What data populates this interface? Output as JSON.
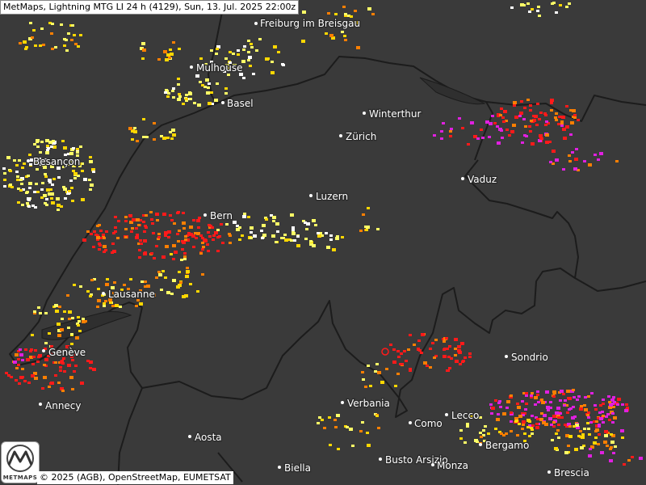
{
  "header": {
    "title": "MetMaps, Lightning MTG LI 24 h (4129), Sun, 13. Jul. 2025 22:00z"
  },
  "footer": {
    "attribution": "© 2025 (AGB), OpenStreetMap, EUMETSAT",
    "logo_text": "METMAPS"
  },
  "colors": {
    "background": "#3a3a3a",
    "border": "#1c1c1c",
    "strike_recent": "#ff1a1a",
    "strike_1": "#ff7f00",
    "strike_2": "#ffd700",
    "strike_3": "#ffff66",
    "strike_older": "#ffffff",
    "strike_foreign": "#e020e0"
  },
  "cities": [
    {
      "name": "Freiburg im Breisgau"
    },
    {
      "name": "Mulhouse"
    },
    {
      "name": "Basel"
    },
    {
      "name": "Winterthur"
    },
    {
      "name": "Zürich"
    },
    {
      "name": "Besançon"
    },
    {
      "name": "Vaduz"
    },
    {
      "name": "Luzern"
    },
    {
      "name": "Bern"
    },
    {
      "name": "Lausanne"
    },
    {
      "name": "Genève"
    },
    {
      "name": "Annecy"
    },
    {
      "name": "Sondrio"
    },
    {
      "name": "Verbania"
    },
    {
      "name": "Lecco"
    },
    {
      "name": "Como"
    },
    {
      "name": "Aosta"
    },
    {
      "name": "Bergamo"
    },
    {
      "name": "Busto Arsizio"
    },
    {
      "name": "Biella"
    },
    {
      "name": "Monza"
    },
    {
      "name": "Brescia"
    }
  ]
}
